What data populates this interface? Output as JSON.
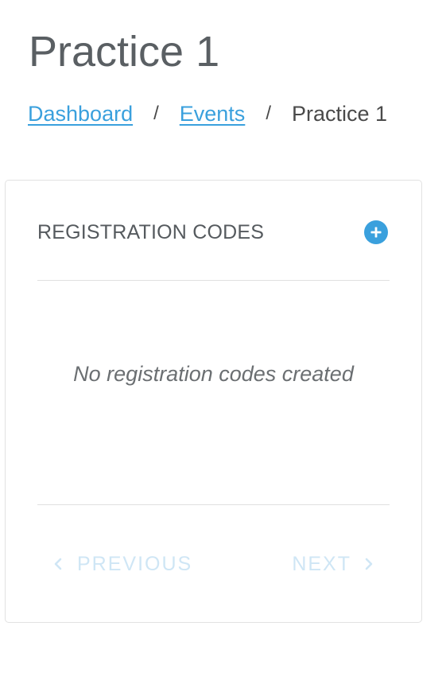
{
  "page": {
    "title": "Practice 1"
  },
  "breadcrumb": {
    "items": [
      {
        "label": "Dashboard"
      },
      {
        "label": "Events"
      },
      {
        "label": "Practice 1"
      }
    ],
    "separator": "/"
  },
  "card": {
    "title": "REGISTRATION CODES",
    "add_icon": "plus-circle-icon",
    "empty_message": "No registration codes created",
    "pagination": {
      "previous_label": "PREVIOUS",
      "next_label": "NEXT",
      "previous_icon": "chevron-left-icon",
      "next_icon": "chevron-right-icon"
    }
  },
  "colors": {
    "accent": "#3aa0dd",
    "text": "#4a4a4a",
    "pager_disabled": "#cfe6f5",
    "border": "#e2e2e2"
  }
}
